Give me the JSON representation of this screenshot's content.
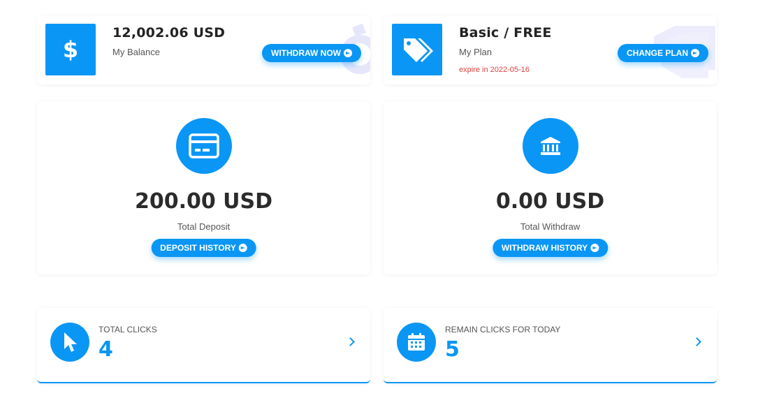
{
  "balance_card": {
    "amount": "12,002.06 USD",
    "label": "My Balance",
    "button_label": "WITHDRAW NOW",
    "icon": "dollar-icon"
  },
  "plan_card": {
    "plan": "Basic / FREE",
    "label": "My Plan",
    "expire": "expire in 2022-05-16",
    "button_label": "CHANGE PLAN",
    "icon": "tags-icon"
  },
  "deposit_card": {
    "amount": "200.00 USD",
    "label": "Total Deposit",
    "button_label": "DEPOSIT HISTORY",
    "icon": "credit-card-icon"
  },
  "withdraw_card": {
    "amount": "0.00 USD",
    "label": "Total Withdraw",
    "button_label": "WITHDRAW HISTORY",
    "icon": "bank-icon"
  },
  "clicks_card": {
    "label": "TOTAL CLICKS",
    "value": "4",
    "icon": "cursor-icon"
  },
  "remain_card": {
    "label": "REMAIN CLICKS FOR TODAY",
    "value": "5",
    "icon": "calendar-icon"
  },
  "colors": {
    "accent": "#0a96f5",
    "expire_text": "#e04040"
  }
}
